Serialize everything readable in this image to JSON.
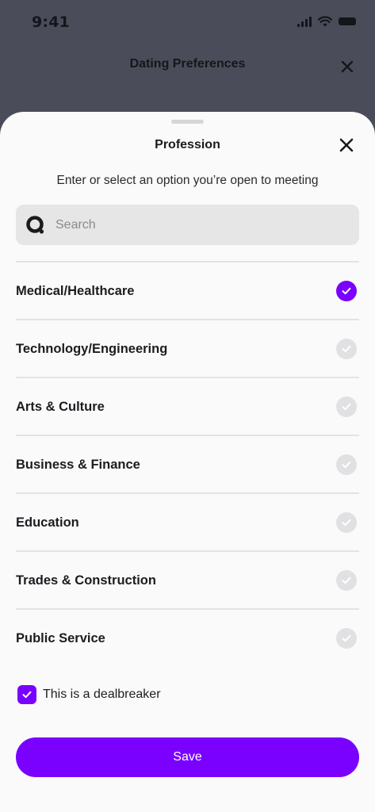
{
  "status_bar": {
    "time": "9:41"
  },
  "background_screen": {
    "title": "Dating Preferences"
  },
  "sheet": {
    "title": "Profession",
    "subtitle": "Enter or select an option you’re open to meeting",
    "search": {
      "placeholder": "Search",
      "value": ""
    },
    "options": [
      {
        "label": "Medical/Healthcare",
        "selected": true
      },
      {
        "label": "Technology/Engineering",
        "selected": false
      },
      {
        "label": "Arts & Culture",
        "selected": false
      },
      {
        "label": "Business & Finance",
        "selected": false
      },
      {
        "label": "Education",
        "selected": false
      },
      {
        "label": "Trades & Construction",
        "selected": false
      },
      {
        "label": "Public Service",
        "selected": false
      }
    ],
    "dealbreaker": {
      "label": "This is a dealbreaker",
      "checked": true
    },
    "save_label": "Save"
  },
  "colors": {
    "accent": "#7a00ff",
    "overlay": "#4a4d59",
    "sheet_background": "#fafafa",
    "unselected_check": "#e1e1e3"
  }
}
